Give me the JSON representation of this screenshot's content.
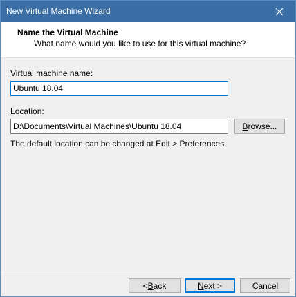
{
  "window": {
    "title": "New Virtual Machine Wizard",
    "close_glyph": "✕"
  },
  "header": {
    "title": "Name the Virtual Machine",
    "subtitle": "What name would you like to use for this virtual machine?"
  },
  "vm_name": {
    "label_accel": "V",
    "label_rest": "irtual machine name:",
    "value": "Ubuntu 18.04"
  },
  "location": {
    "label_accel": "L",
    "label_rest": "ocation:",
    "value": "D:\\Documents\\Virtual Machines\\Ubuntu 18.04",
    "browse_accel": "B",
    "browse_rest": "rowse..."
  },
  "note": "The default location can be changed at Edit > Preferences.",
  "footer": {
    "back_prefix": "< ",
    "back_accel": "B",
    "back_rest": "ack",
    "next_accel": "N",
    "next_rest": "ext >",
    "cancel": "Cancel"
  },
  "colors": {
    "titlebar": "#3a6ea5",
    "focus_accent": "#0078d7"
  },
  "icons": {
    "close": "close-icon"
  }
}
